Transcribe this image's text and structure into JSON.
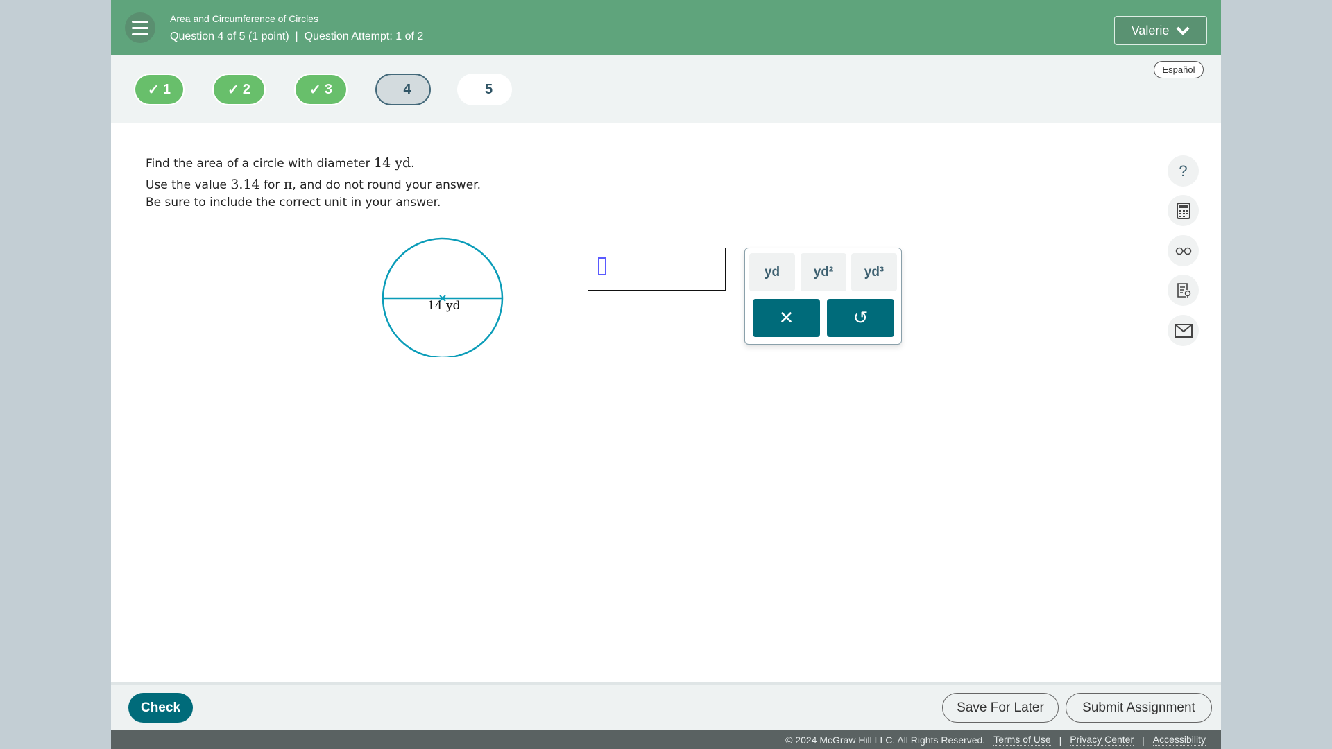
{
  "header": {
    "title": "Area and Circumference of Circles",
    "question_info": "Question 4 of 5 (1 point)",
    "separator": "|",
    "attempt": "Question Attempt: 1 of 2",
    "user": "Valerie"
  },
  "nav": {
    "questions": [
      {
        "label": "1",
        "status": "done"
      },
      {
        "label": "2",
        "status": "done"
      },
      {
        "label": "3",
        "status": "done"
      },
      {
        "label": "4",
        "status": "current"
      },
      {
        "label": "5",
        "status": "unanswered"
      }
    ],
    "language": "Español"
  },
  "question": {
    "line1_a": "Find the area of a circle with diameter ",
    "line1_m": "14 yd",
    "line1_b": ".",
    "line2_a": "Use the value ",
    "line2_m": "3.14",
    "line2_b": " for ",
    "line2_pi": "π",
    "line2_c": ", and do not round your answer.",
    "line3": "Be sure to include the correct unit in your answer."
  },
  "figure": {
    "label": "14 yd",
    "color": "#0a9cb8"
  },
  "answer": {
    "value": ""
  },
  "units": [
    "yd",
    "yd²",
    "yd³"
  ],
  "tools": [
    "help-icon",
    "calculator-icon",
    "glasses-icon",
    "notes-icon",
    "mail-icon"
  ],
  "bottom": {
    "check": "Check",
    "save": "Save For Later",
    "submit": "Submit Assignment"
  },
  "footer": {
    "copyright": "© 2024 McGraw Hill LLC. All Rights Reserved.",
    "terms": "Terms of Use",
    "privacy": "Privacy Center",
    "accessibility": "Accessibility",
    "sep": "|"
  },
  "colors": {
    "header": "#5fa47c",
    "done": "#68bf6b",
    "accent": "#006b7a"
  }
}
